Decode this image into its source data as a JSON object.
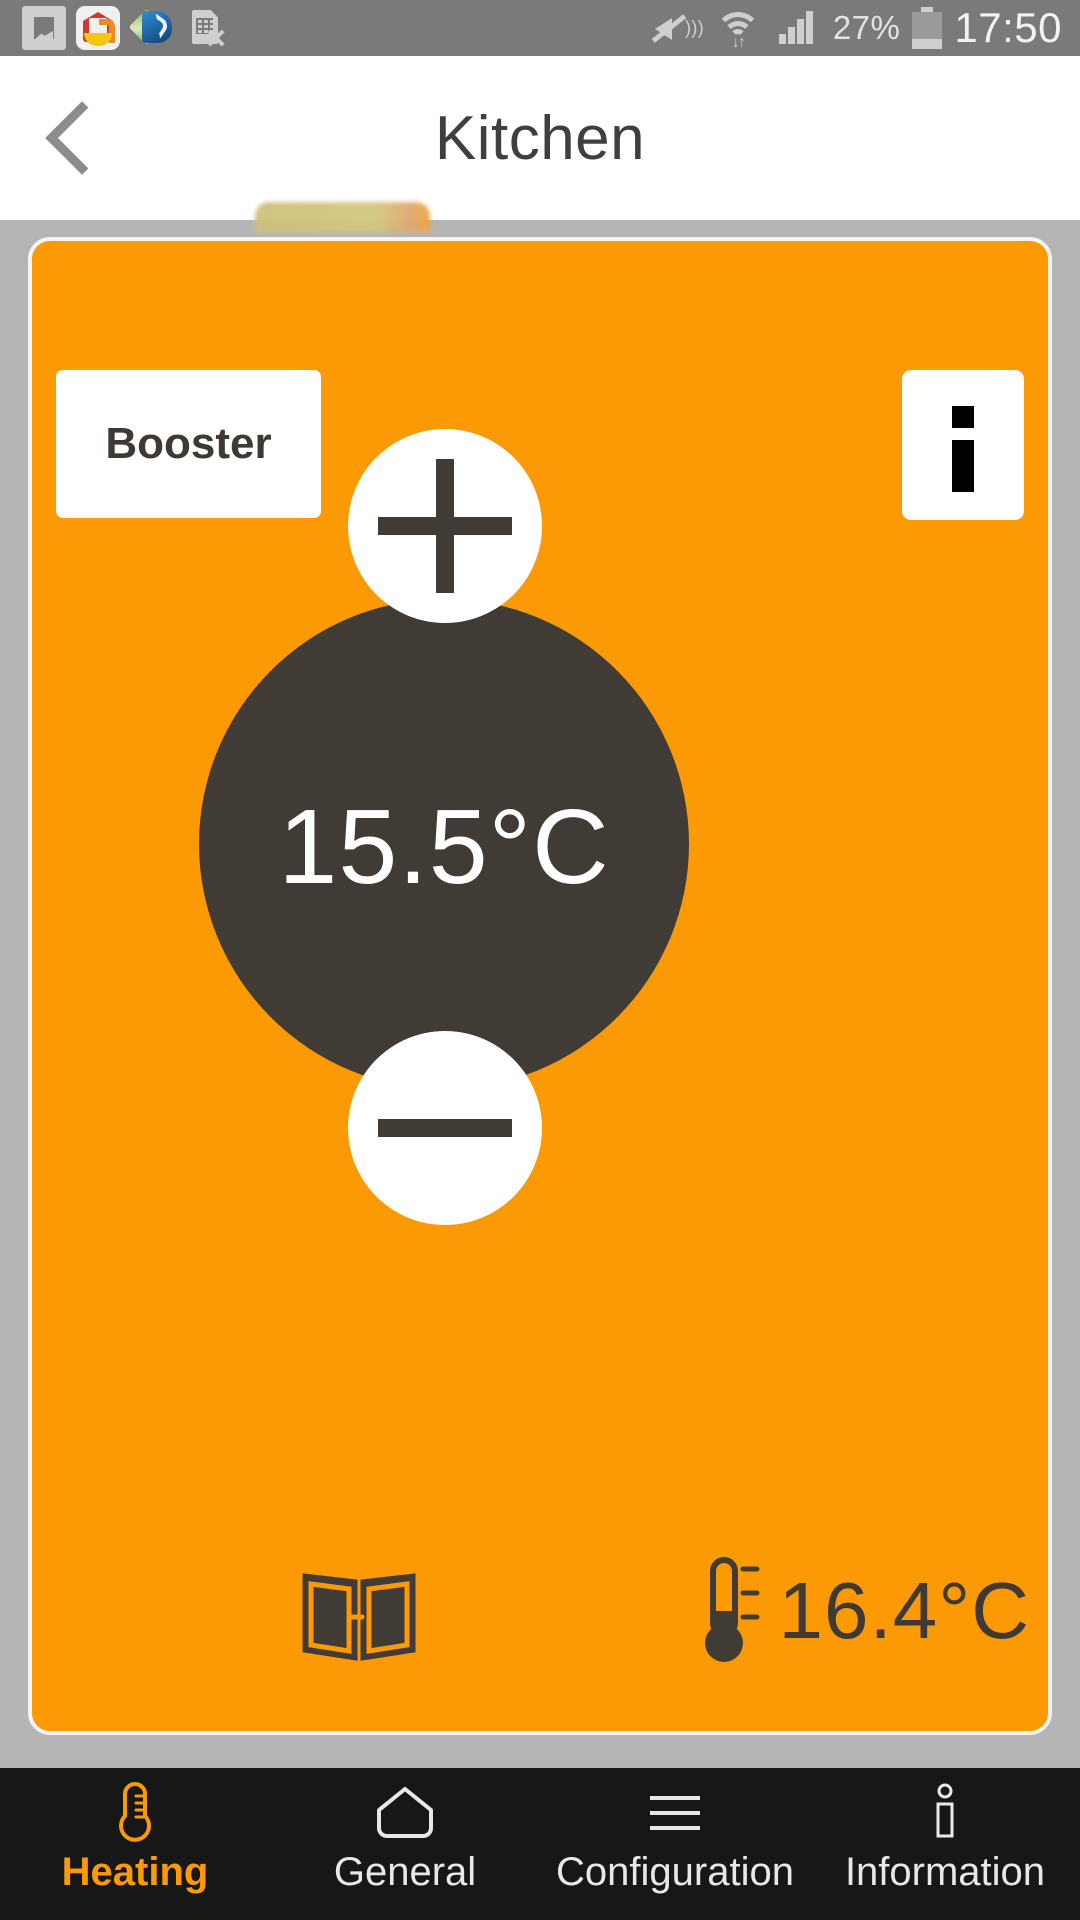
{
  "status_bar": {
    "notifications": [
      {
        "icon": "gallery-image-icon"
      },
      {
        "icon": "home-app-icon"
      },
      {
        "icon": "blue-app-icon"
      },
      {
        "icon": "document-error-icon"
      }
    ],
    "mute_icon": "mute-vibrate-icon",
    "wifi_icon": "wifi-transfer-icon",
    "signal_icon": "cellular-signal-icon",
    "battery_percent": "27%",
    "battery_icon": "battery-icon",
    "time": "17:50"
  },
  "header": {
    "back_icon": "back-chevron-icon",
    "title": "Kitchen"
  },
  "card": {
    "booster_label": "Booster",
    "info_icon": "info-i-icon",
    "target_temperature": "15.5°C",
    "increase_icon": "plus-icon",
    "decrease_icon": "minus-icon",
    "window_icon": "window-open-icon",
    "thermometer_icon": "thermometer-icon",
    "current_temperature": "16.4°C"
  },
  "bottom_nav": {
    "items": [
      {
        "label": "Heating",
        "icon": "thermometer-icon",
        "active": true
      },
      {
        "label": "General",
        "icon": "house-icon",
        "active": false
      },
      {
        "label": "Configuration",
        "icon": "hamburger-menu-icon",
        "active": false
      },
      {
        "label": "Information",
        "icon": "info-outline-icon",
        "active": false
      }
    ]
  },
  "colors": {
    "accent_orange": "#fb9a05",
    "dial_dark": "#403c35",
    "page_background": "#b5b5b5",
    "nav_background": "#171717",
    "status_bar": "#7a7a7a"
  }
}
